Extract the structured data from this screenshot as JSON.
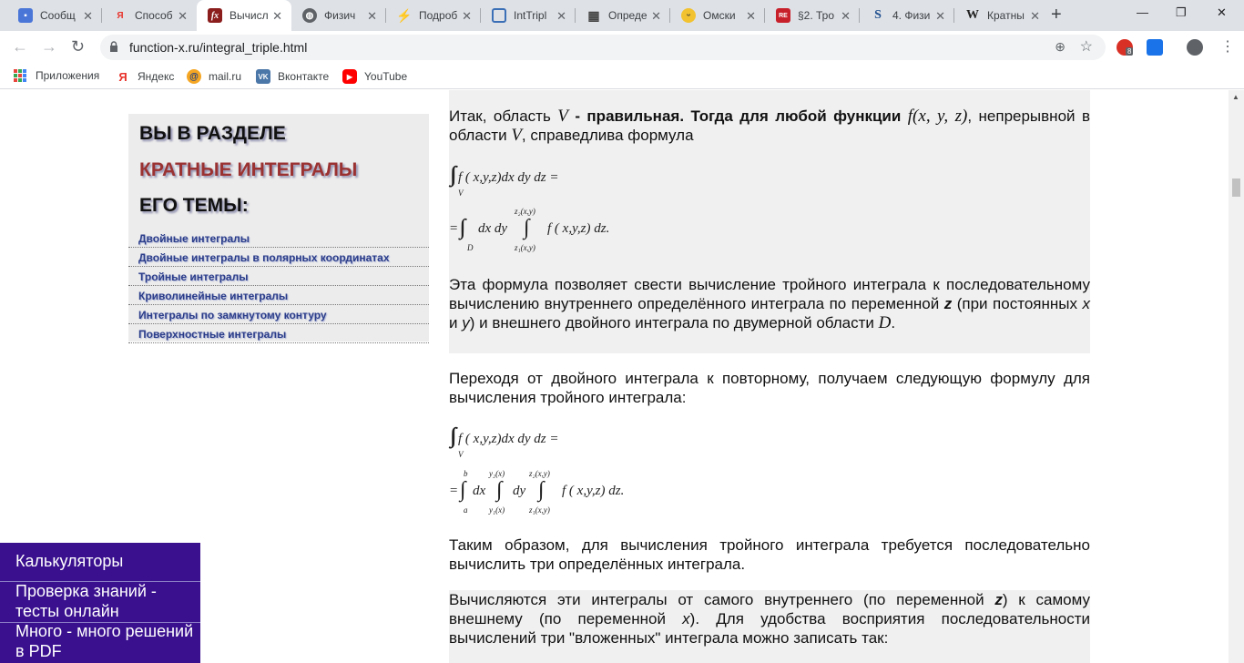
{
  "window": {
    "tabs": [
      {
        "title": "Сообщ",
        "icon": "chat-icon",
        "color": "#4a76d8"
      },
      {
        "title": "Способ",
        "icon": "yandex-icon",
        "color": "#ffffff"
      },
      {
        "title": "Вычисл",
        "icon": "fx-icon",
        "color": "#8b1d1d"
      },
      {
        "title": "Физич",
        "icon": "globe-icon",
        "color": "#5f6368"
      },
      {
        "title": "Подроб",
        "icon": "lightning-icon",
        "color": "#e8332c"
      },
      {
        "title": "IntTripl",
        "icon": "book-icon",
        "color": "#3b6fb6"
      },
      {
        "title": "Опреде",
        "icon": "grid-icon",
        "color": "#444444"
      },
      {
        "title": "Омски",
        "icon": "smiley-icon",
        "color": "#f2c230"
      },
      {
        "title": "§2. Тро",
        "icon": "reshot-icon",
        "color": "#c8202b"
      },
      {
        "title": "4. Физи",
        "icon": "s-icon",
        "color": "#1f4f8f"
      },
      {
        "title": "Кратны",
        "icon": "wikipedia-icon",
        "color": "#222222"
      }
    ],
    "active_tab": 2
  },
  "toolbar": {
    "url": "function-x.ru/integral_triple.html",
    "ext_badge": "8"
  },
  "bookmarks": [
    {
      "label": "Приложения",
      "icon": "apps-grid-icon"
    },
    {
      "label": "Яндекс",
      "icon": "yandex-icon"
    },
    {
      "label": "mail.ru",
      "icon": "mail-at-icon"
    },
    {
      "label": "Вконтакте",
      "icon": "vk-icon"
    },
    {
      "label": "YouTube",
      "icon": "youtube-icon"
    }
  ],
  "sidebar": {
    "heading1": "ВЫ В РАЗДЕЛЕ",
    "heading2": "КРАТНЫЕ ИНТЕГРАЛЫ",
    "heading3": "ЕГО ТЕМЫ:",
    "links": [
      "Двойные интегралы",
      "Двойные интегралы в полярных координатах",
      "Тройные интегралы",
      "Криволинейные интегралы",
      "Интегралы по замкнутому контуру",
      "Поверхностные интегралы"
    ]
  },
  "bottom_menu": {
    "items": [
      "Калькуляторы",
      "Проверка знаний - тесты онлайн",
      "Много - много решений в PDF"
    ]
  },
  "content": {
    "p1_a": "Итак, область ",
    "p1_var1": "V",
    "p1_b": " - правильная. Тогда для любой функции ",
    "p1_func": "f(x, y, z)",
    "p1_c": ", непрерывной в области ",
    "p1_var2": "V",
    "p1_d": ", справедлива формула",
    "f1_line1": "f ( x,y,z)dx dy dz =",
    "f1_line2_a": "= ",
    "f1_line2_b": "dx dy",
    "f1_line2_c": "f ( x,y,z) dz.",
    "f1_sub_v": "V",
    "f1_sub_d": "D",
    "f1_upper": "z₂(x,y)",
    "f1_lower": "z₁(x,y)",
    "p2_a": "Эта формула позволяет свести вычисление тройного интеграла к последовательному вычислению внутреннего определённого интеграла по переменной ",
    "p2_z": "z",
    "p2_b": " (при постоянных ",
    "p2_x": "x",
    "p2_c": " и ",
    "p2_y": "y",
    "p2_d": ") и внешнего двойного интеграла по двумерной области ",
    "p2_dom": "D",
    "p2_e": ".",
    "p3": "Переходя от двойного интеграла к повторному, получаем следующую формулу для вычисления тройного интеграла:",
    "f2_line1": "f ( x,y,z)dx dy dz =",
    "f2_line2_dx": "dx",
    "f2_line2_dy": "dy",
    "f2_line2_c": "f ( x,y,z) dz.",
    "f2_b": "b",
    "f2_a": "a",
    "f2_y2": "y₂(x)",
    "f2_y1": "y₁(x)",
    "f2_z2": "z₂(x,y)",
    "f2_z1": "z₁(x,y)",
    "p4": "Таким образом, для вычисления тройного интеграла требуется последовательно вычислить три определённых интеграла.",
    "p5_a": "Вычисляются эти интегралы от самого внутреннего (по переменной ",
    "p5_z": "z",
    "p5_b": ") к самому внешнему (по переменной ",
    "p5_x": "x",
    "p5_c": "). Для удобства восприятия последовательности вычислений три \"вложенных\" интеграла можно записать так:"
  },
  "colors": {
    "sidebar_bg": "#ececec",
    "menu_bg": "#3a108f",
    "link": "#2b3d8a",
    "section_red": "#9b3232"
  }
}
